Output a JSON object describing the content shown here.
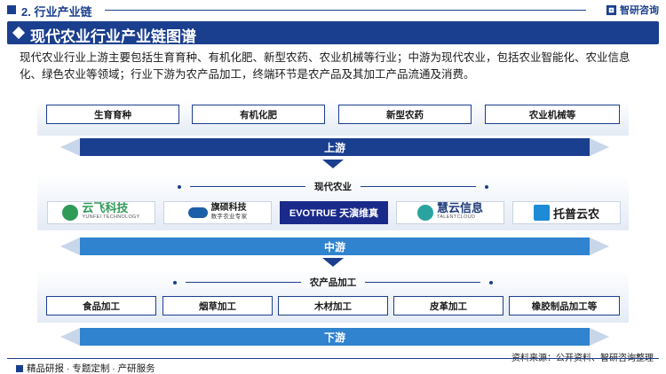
{
  "header": {
    "section_title": "2. 行业产业链",
    "brand": "智研咨询",
    "page_title": "现代农业行业产业链图谱"
  },
  "intro": "现代农业行业上游主要包括生育育种、有机化肥、新型农药、农业机械等行业；中游为现代农业，包括农业智能化、农业信息化、绿色农业等领域；行业下游为农产品加工，终端环节是农产品及其加工产品流通及消费。",
  "upstream": {
    "items": [
      "生育育种",
      "有机化肥",
      "新型农药",
      "农业机械等"
    ],
    "bar_label": "上游"
  },
  "midstream": {
    "category": "现代农业",
    "companies": [
      {
        "name": "云飞科技",
        "sub": "YUNFEI TECHNOLOGY",
        "icon": "yunfei-logo-icon"
      },
      {
        "name": "旗硕科技",
        "sub": "数字农业专家",
        "icon": "qishuo-logo-icon"
      },
      {
        "name": "EVOTRUE 天演维真",
        "sub": "",
        "icon": "evotrue-logo-icon"
      },
      {
        "name": "慧云信息",
        "sub": "TALENTCLOUD",
        "icon": "huiyun-logo-icon"
      },
      {
        "name": "托普云农",
        "sub": "",
        "icon": "top-cloud-logo-icon"
      }
    ],
    "bar_label": "中游"
  },
  "downstream": {
    "category": "农产品加工",
    "items": [
      "食品加工",
      "烟草加工",
      "木材加工",
      "皮革加工",
      "橡胶制品加工等"
    ],
    "bar_label": "下游"
  },
  "footer": {
    "left": "精品研报 · 专题定制 · 产研服务",
    "source": "资料来源：公开资料、智研咨询整理"
  },
  "colors": {
    "primary": "#1b3f8f",
    "accent": "#2f83cf",
    "panel": "#e4ebf5"
  }
}
